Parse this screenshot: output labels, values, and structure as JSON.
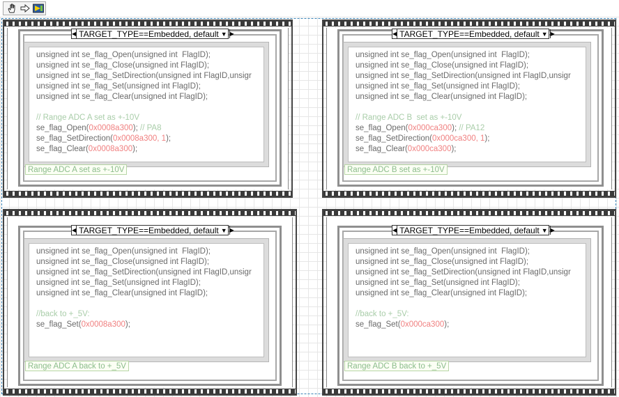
{
  "toolbar": {
    "icons": [
      "hand-icon",
      "arrow-icon",
      "run-icon"
    ]
  },
  "selector_text": "TARGET_TYPE==Embedded, default",
  "panels": [
    {
      "lines": [
        [
          [
            "p",
            "unsigned int "
          ],
          [
            "p",
            "se_flag_Open("
          ],
          [
            "p",
            "unsigned int  FlagID);"
          ]
        ],
        [
          [
            "p",
            "unsigned int "
          ],
          [
            "p",
            "se_flag_Close("
          ],
          [
            "p",
            "unsigned int FlagID);"
          ]
        ],
        [
          [
            "p",
            "unsigned int "
          ],
          [
            "p",
            "se_flag_SetDirection("
          ],
          [
            "p",
            "unsigned int FlagID,unsigr"
          ]
        ],
        [
          [
            "p",
            "unsigned int "
          ],
          [
            "p",
            "se_flag_Set("
          ],
          [
            "p",
            "unsigned int FlagID);"
          ]
        ],
        [
          [
            "p",
            "unsigned int "
          ],
          [
            "p",
            "se_flag_Clear("
          ],
          [
            "p",
            "unsigned int FlagID);"
          ]
        ],
        [],
        [
          [
            "c",
            "// Range ADC A set as +-10V"
          ]
        ],
        [
          [
            "p",
            "se_flag_Open("
          ],
          [
            "n",
            "0x0008a300"
          ],
          [
            "p",
            "); "
          ],
          [
            "c",
            "// PA8"
          ]
        ],
        [
          [
            "p",
            "se_flag_SetDirection("
          ],
          [
            "n",
            "0x0008a300, 1"
          ],
          [
            "p",
            ");"
          ]
        ],
        [
          [
            "p",
            "se_flag_Clear("
          ],
          [
            "n",
            "0x0008a300"
          ],
          [
            "p",
            ");"
          ]
        ]
      ],
      "label": "Range ADC A set as +-10V"
    },
    {
      "lines": [
        [
          [
            "p",
            "unsigned int "
          ],
          [
            "p",
            "se_flag_Open("
          ],
          [
            "p",
            "unsigned int  FlagID);"
          ]
        ],
        [
          [
            "p",
            "unsigned int "
          ],
          [
            "p",
            "se_flag_Close("
          ],
          [
            "p",
            "unsigned int FlagID);"
          ]
        ],
        [
          [
            "p",
            "unsigned int "
          ],
          [
            "p",
            "se_flag_SetDirection("
          ],
          [
            "p",
            "unsigned int FlagID,unsigr"
          ]
        ],
        [
          [
            "p",
            "unsigned int "
          ],
          [
            "p",
            "se_flag_Set("
          ],
          [
            "p",
            "unsigned int FlagID);"
          ]
        ],
        [
          [
            "p",
            "unsigned int "
          ],
          [
            "p",
            "se_flag_Clear("
          ],
          [
            "p",
            "unsigned int FlagID);"
          ]
        ],
        [],
        [
          [
            "c",
            "// Range ADC B  set as +-10V"
          ]
        ],
        [
          [
            "p",
            "se_flag_Open("
          ],
          [
            "n",
            "0x000ca300"
          ],
          [
            "p",
            "); "
          ],
          [
            "c",
            "// PA12"
          ]
        ],
        [
          [
            "p",
            "se_flag_SetDirection("
          ],
          [
            "n",
            "0x000ca300, 1"
          ],
          [
            "p",
            ");"
          ]
        ],
        [
          [
            "p",
            "se_flag_Clear("
          ],
          [
            "n",
            "0x000ca300"
          ],
          [
            "p",
            ");"
          ]
        ]
      ],
      "label": "Range ADC B set as +-10V"
    },
    {
      "lines": [
        [
          [
            "p",
            "unsigned int "
          ],
          [
            "p",
            "se_flag_Open("
          ],
          [
            "p",
            "unsigned int  FlagID);"
          ]
        ],
        [
          [
            "p",
            "unsigned int "
          ],
          [
            "p",
            "se_flag_Close("
          ],
          [
            "p",
            "unsigned int FlagID);"
          ]
        ],
        [
          [
            "p",
            "unsigned int "
          ],
          [
            "p",
            "se_flag_SetDirection("
          ],
          [
            "p",
            "unsigned int FlagID,unsigr"
          ]
        ],
        [
          [
            "p",
            "unsigned int "
          ],
          [
            "p",
            "se_flag_Set("
          ],
          [
            "p",
            "unsigned int FlagID);"
          ]
        ],
        [
          [
            "p",
            "unsigned int "
          ],
          [
            "p",
            "se_flag_Clear("
          ],
          [
            "p",
            "unsigned int FlagID);"
          ]
        ],
        [],
        [
          [
            "c",
            "//back to +_5V:"
          ]
        ],
        [
          [
            "p",
            "se_flag_Set("
          ],
          [
            "n",
            "0x0008a300"
          ],
          [
            "p",
            ");"
          ]
        ]
      ],
      "label": "Range ADC A back to +_5V"
    },
    {
      "lines": [
        [
          [
            "p",
            "unsigned int "
          ],
          [
            "p",
            "se_flag_Open("
          ],
          [
            "p",
            "unsigned int  FlagID);"
          ]
        ],
        [
          [
            "p",
            "unsigned int "
          ],
          [
            "p",
            "se_flag_Close("
          ],
          [
            "p",
            "unsigned int FlagID);"
          ]
        ],
        [
          [
            "p",
            "unsigned int "
          ],
          [
            "p",
            "se_flag_SetDirection("
          ],
          [
            "p",
            "unsigned int FlagID,unsigr"
          ]
        ],
        [
          [
            "p",
            "unsigned int "
          ],
          [
            "p",
            "se_flag_Set("
          ],
          [
            "p",
            "unsigned int FlagID);"
          ]
        ],
        [
          [
            "p",
            "unsigned int "
          ],
          [
            "p",
            "se_flag_Clear("
          ],
          [
            "p",
            "unsigned int FlagID);"
          ]
        ],
        [],
        [
          [
            "c",
            "//back to +_5V:"
          ]
        ],
        [
          [
            "p",
            "se_flag_Set("
          ],
          [
            "n",
            "0x000ca300"
          ],
          [
            "p",
            ");"
          ]
        ]
      ],
      "label": "Range ADC B back to +_5V"
    }
  ]
}
